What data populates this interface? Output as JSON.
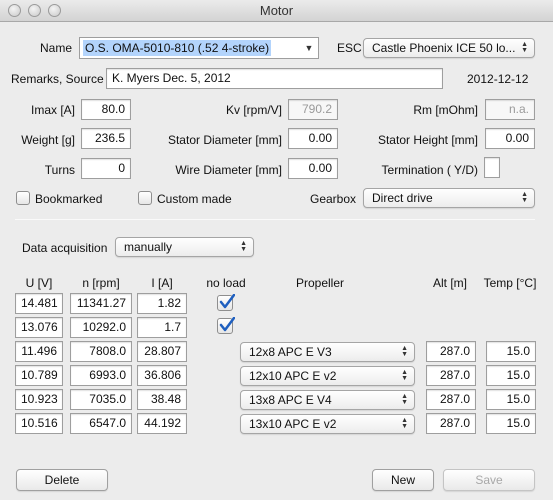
{
  "window": {
    "title": "Motor"
  },
  "form": {
    "name_label": "Name",
    "name_value": "O.S. OMA-5010-810 (.52 4-stroke)",
    "esc_label": "ESC",
    "esc_value": "Castle Phoenix ICE 50 lo...",
    "remarks_label": "Remarks, Source",
    "remarks_value": "K. Myers Dec. 5, 2012",
    "date": "2012-12-12",
    "imax_label": "Imax [A]",
    "imax_value": "80.0",
    "kv_label": "Kv [rpm/V]",
    "kv_value": "790.2",
    "rm_label": "Rm [mOhm]",
    "rm_value": "n.a.",
    "weight_label": "Weight [g]",
    "weight_value": "236.5",
    "stator_diameter_label": "Stator Diameter [mm]",
    "stator_diameter_value": "0.00",
    "stator_height_label": "Stator Height [mm]",
    "stator_height_value": "0.00",
    "turns_label": "Turns",
    "turns_value": "0",
    "wire_diameter_label": "Wire Diameter [mm]",
    "wire_diameter_value": "0.00",
    "termination_label": "Termination ( Y/D)",
    "termination_value": "",
    "bookmarked_label": "Bookmarked",
    "bookmarked_checked": false,
    "custom_made_label": "Custom made",
    "custom_made_checked": false,
    "gearbox_label": "Gearbox",
    "gearbox_value": "Direct drive"
  },
  "acquisition": {
    "label": "Data acquisition",
    "value": "manually"
  },
  "table": {
    "headers": {
      "u": "U [V]",
      "n": "n [rpm]",
      "i": "I [A]",
      "noload": "no load",
      "propeller": "Propeller",
      "alt": "Alt [m]",
      "temp": "Temp [°C]"
    },
    "rows": [
      {
        "u": "14.481",
        "n": "11341.27",
        "i": "1.82",
        "noload": true,
        "propeller": "",
        "alt": "",
        "temp": ""
      },
      {
        "u": "13.076",
        "n": "10292.0",
        "i": "1.7",
        "noload": true,
        "propeller": "",
        "alt": "",
        "temp": ""
      },
      {
        "u": "11.496",
        "n": "7808.0",
        "i": "28.807",
        "noload": false,
        "propeller": "12x8 APC E V3",
        "alt": "287.0",
        "temp": "15.0"
      },
      {
        "u": "10.789",
        "n": "6993.0",
        "i": "36.806",
        "noload": false,
        "propeller": "12x10 APC E v2",
        "alt": "287.0",
        "temp": "15.0"
      },
      {
        "u": "10.923",
        "n": "7035.0",
        "i": "38.48",
        "noload": false,
        "propeller": "13x8 APC E V4",
        "alt": "287.0",
        "temp": "15.0"
      },
      {
        "u": "10.516",
        "n": "6547.0",
        "i": "44.192",
        "noload": false,
        "propeller": "13x10 APC E v2",
        "alt": "287.0",
        "temp": "15.0"
      }
    ]
  },
  "buttons": {
    "delete": "Delete",
    "new": "New",
    "save": "Save"
  },
  "colors": {
    "selection": "#b3d4fc",
    "check_blue": "#1f5fbf"
  },
  "icons": {
    "dropdown": "updown-arrows-icon",
    "checkmark": "checkmark-icon"
  }
}
